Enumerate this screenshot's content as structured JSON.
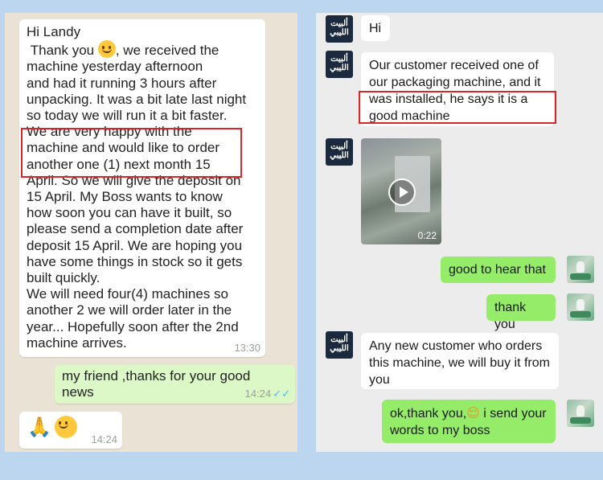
{
  "whatsapp": {
    "message_1": {
      "greeting": "Hi Landy",
      "thank_you": "Thank you",
      "line_after_emoji": ", we received the",
      "body": "machine yesterday afternoon\nand had it running 3 hours after\nunpacking. It was a bit late last night\nso today we will run it a bit faster.\nWe are very happy with the\nmachine and would like to order\nanother one (1) next month 15\nApril. So we will give the deposit on\n15 April. My Boss wants to know\nhow soon you can have it built, so\nplease send a completion date after\ndeposit 15 April. We are hoping you\nhave some things in stock so it gets\nbuilt quickly.\nWe will need four(4) machines so\nanother 2 we will order later in the\nyear... Hopefully soon after the 2nd\nmachine arrives.",
      "time": "13:30"
    },
    "message_2": {
      "text": "my friend ,thanks for your good\nnews",
      "time": "14:24",
      "ticks": "✓✓"
    },
    "message_3": {
      "emojis": "🙏",
      "time": "14:24"
    }
  },
  "wechat": {
    "contact_logo_text": "ألبيت الليبي",
    "messages": [
      {
        "from": "contact",
        "text": "Hi"
      },
      {
        "from": "contact",
        "text": "Our customer received one of our packaging machine, and it was installed, he says it is a good machine"
      },
      {
        "from": "contact",
        "type": "video",
        "duration": "0:22"
      },
      {
        "from": "me",
        "text": "good to hear that"
      },
      {
        "from": "me",
        "text": "thank you"
      },
      {
        "from": "contact",
        "text": "Any new customer who orders this machine, we will buy it from you"
      },
      {
        "from": "me",
        "text_before_emoji": "ok,thank you,",
        "emoji": "😌",
        "text_after_emoji": " i send your words to my boss"
      }
    ]
  },
  "colors": {
    "highlight_border": "#d8262b",
    "wechat_out_bubble": "#95ec69",
    "whatsapp_out_bubble": "#dcf8c6"
  }
}
